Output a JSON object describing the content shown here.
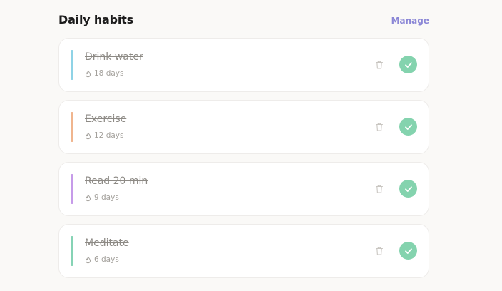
{
  "header": {
    "title": "Daily habits",
    "manage_label": "Manage"
  },
  "colors": {
    "accent_link": "#8a86d6",
    "check_fill": "#84d3ae"
  },
  "habits": [
    {
      "name": "Drink water",
      "streak": "18 days",
      "accent": "#8fd3e6",
      "completed": true
    },
    {
      "name": "Exercise",
      "streak": "12 days",
      "accent": "#f0b58e",
      "completed": true
    },
    {
      "name": "Read 20 min",
      "streak": "9 days",
      "accent": "#c69be9",
      "completed": true
    },
    {
      "name": "Meditate",
      "streak": "6 days",
      "accent": "#86d3b5",
      "completed": true
    }
  ],
  "icons": {
    "streak": "flame-icon",
    "delete": "trash-icon",
    "done": "check-icon"
  }
}
